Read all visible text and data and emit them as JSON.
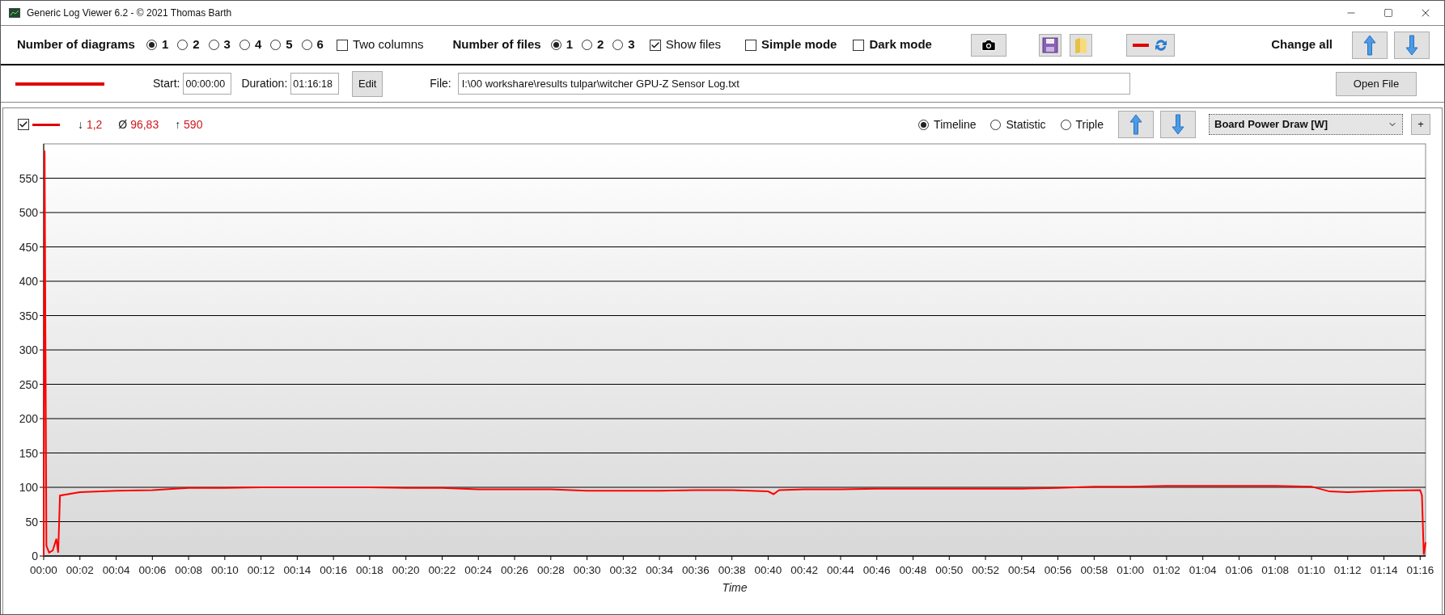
{
  "window": {
    "title": "Generic Log Viewer 6.2 - © 2021 Thomas Barth"
  },
  "toolbar": {
    "diagrams": {
      "label": "Number of diagrams",
      "options": [
        {
          "label": "1",
          "selected": true
        },
        {
          "label": "2",
          "selected": false
        },
        {
          "label": "3",
          "selected": false
        },
        {
          "label": "4",
          "selected": false
        },
        {
          "label": "5",
          "selected": false
        },
        {
          "label": "6",
          "selected": false
        }
      ]
    },
    "two_columns": {
      "label": "Two columns",
      "checked": false
    },
    "files": {
      "label": "Number of files",
      "options": [
        {
          "label": "1",
          "selected": true
        },
        {
          "label": "2",
          "selected": false
        },
        {
          "label": "3",
          "selected": false
        }
      ]
    },
    "show_files": {
      "label": "Show files",
      "checked": true
    },
    "simple_mode": {
      "label": "Simple mode",
      "checked": false
    },
    "dark_mode": {
      "label": "Dark mode",
      "checked": false
    },
    "change_all": "Change all"
  },
  "file_row": {
    "start_label": "Start:",
    "start": "00:00:00",
    "duration_label": "Duration:",
    "duration": "01:16:18",
    "edit_button": "Edit",
    "file_label": "File:",
    "file_path": "I:\\00 workshare\\results tulpar\\witcher GPU-Z Sensor Log.txt",
    "open_button": "Open File"
  },
  "diagram": {
    "visible": {
      "checked": true
    },
    "stats": [
      {
        "symbol": "↓",
        "value": "1,2"
      },
      {
        "symbol": "Ø",
        "value": "96,83"
      },
      {
        "symbol": "↑",
        "value": "590"
      }
    ],
    "views": [
      {
        "label": "Timeline",
        "selected": true
      },
      {
        "label": "Statistic",
        "selected": false
      },
      {
        "label": "Triple",
        "selected": false
      }
    ],
    "channel": "Board Power Draw [W]",
    "add_button": "+",
    "chart_data": {
      "type": "line",
      "xlabel": "Time",
      "x": [
        0,
        0.05,
        0.15,
        0.3,
        0.5,
        0.7,
        0.8,
        0.9,
        2,
        4,
        6,
        8,
        10,
        12,
        14,
        16,
        18,
        20,
        22,
        24,
        26,
        28,
        30,
        32,
        34,
        36,
        38,
        40,
        40.3,
        40.6,
        42,
        44,
        46,
        48,
        50,
        52,
        54,
        56,
        58,
        60,
        62,
        64,
        66,
        68,
        70,
        71,
        72,
        74,
        76,
        76.1,
        76.2,
        76.3
      ],
      "grid": true,
      "series": [
        {
          "color": "#ff0000",
          "values": [
            0,
            590,
            15,
            5,
            8,
            25,
            5,
            88,
            93,
            95,
            96,
            99,
            99,
            100,
            100,
            100,
            100,
            99,
            99,
            97,
            97,
            97,
            95,
            95,
            95,
            96,
            96,
            94,
            90,
            96,
            97,
            97,
            98,
            98,
            98,
            98,
            98,
            99,
            101,
            101,
            102,
            102,
            102,
            102,
            101,
            94,
            93,
            95,
            96,
            88,
            2,
            20
          ]
        }
      ],
      "xlim": [
        0,
        76.3
      ],
      "ylim": [
        0,
        600
      ],
      "xticks": [
        {
          "value": 0,
          "label": "00:00"
        },
        {
          "value": 2,
          "label": "00:02"
        },
        {
          "value": 4,
          "label": "00:04"
        },
        {
          "value": 6,
          "label": "00:06"
        },
        {
          "value": 8,
          "label": "00:08"
        },
        {
          "value": 10,
          "label": "00:10"
        },
        {
          "value": 12,
          "label": "00:12"
        },
        {
          "value": 14,
          "label": "00:14"
        },
        {
          "value": 16,
          "label": "00:16"
        },
        {
          "value": 18,
          "label": "00:18"
        },
        {
          "value": 20,
          "label": "00:20"
        },
        {
          "value": 22,
          "label": "00:22"
        },
        {
          "value": 24,
          "label": "00:24"
        },
        {
          "value": 26,
          "label": "00:26"
        },
        {
          "value": 28,
          "label": "00:28"
        },
        {
          "value": 30,
          "label": "00:30"
        },
        {
          "value": 32,
          "label": "00:32"
        },
        {
          "value": 34,
          "label": "00:34"
        },
        {
          "value": 36,
          "label": "00:36"
        },
        {
          "value": 38,
          "label": "00:38"
        },
        {
          "value": 40,
          "label": "00:40"
        },
        {
          "value": 42,
          "label": "00:42"
        },
        {
          "value": 44,
          "label": "00:44"
        },
        {
          "value": 46,
          "label": "00:46"
        },
        {
          "value": 48,
          "label": "00:48"
        },
        {
          "value": 50,
          "label": "00:50"
        },
        {
          "value": 52,
          "label": "00:52"
        },
        {
          "value": 54,
          "label": "00:54"
        },
        {
          "value": 56,
          "label": "00:56"
        },
        {
          "value": 58,
          "label": "00:58"
        },
        {
          "value": 60,
          "label": "01:00"
        },
        {
          "value": 62,
          "label": "01:02"
        },
        {
          "value": 64,
          "label": "01:04"
        },
        {
          "value": 66,
          "label": "01:06"
        },
        {
          "value": 68,
          "label": "01:08"
        },
        {
          "value": 70,
          "label": "01:10"
        },
        {
          "value": 72,
          "label": "01:12"
        },
        {
          "value": 74,
          "label": "01:14"
        },
        {
          "value": 76,
          "label": "01:16"
        }
      ],
      "yticks": [
        0,
        50,
        100,
        150,
        200,
        250,
        300,
        350,
        400,
        450,
        500,
        550
      ]
    }
  }
}
